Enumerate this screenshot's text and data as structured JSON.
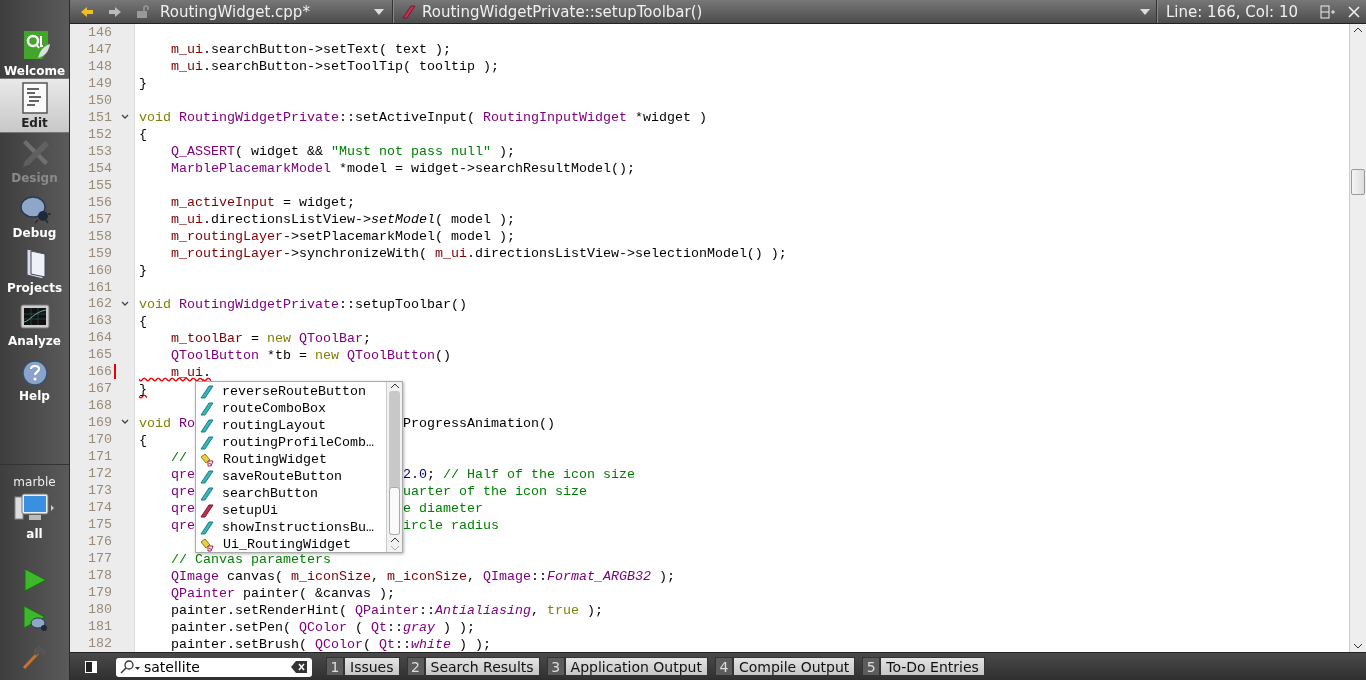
{
  "toolbar": {
    "file": "RoutingWidget.cpp*",
    "symbol": "RoutingWidgetPrivate::setupToolbar()",
    "position": "Line: 166, Col: 10"
  },
  "modes": [
    {
      "kind": "welcome",
      "label": "Welcome",
      "selected": false,
      "disabled": false
    },
    {
      "kind": "edit",
      "label": "Edit",
      "selected": true,
      "disabled": false
    },
    {
      "kind": "design",
      "label": "Design",
      "selected": false,
      "disabled": true
    },
    {
      "kind": "debug",
      "label": "Debug",
      "selected": false,
      "disabled": false
    },
    {
      "kind": "projects",
      "label": "Projects",
      "selected": false,
      "disabled": false
    },
    {
      "kind": "analyze",
      "label": "Analyze",
      "selected": false,
      "disabled": false
    },
    {
      "kind": "help",
      "label": "Help",
      "selected": false,
      "disabled": false
    }
  ],
  "target": {
    "project": "marble",
    "build": "all"
  },
  "editor": {
    "lines": [
      {
        "number": "146",
        "fold": false,
        "changed": false
      },
      {
        "number": "147",
        "fold": false,
        "changed": false,
        "error": false,
        "tokens": [
          {
            "kind": "field",
            "text": "    m_ui"
          },
          {
            "kind": "plain",
            "text": ".searchButton->setText( text );"
          }
        ]
      },
      {
        "number": "148",
        "fold": false,
        "changed": false,
        "error": false,
        "tokens": [
          {
            "kind": "field",
            "text": "    m_ui"
          },
          {
            "kind": "plain",
            "text": ".searchButton->setToolTip( tooltip );"
          }
        ]
      },
      {
        "number": "149",
        "fold": false,
        "changed": false,
        "error": false,
        "tokens": [
          {
            "kind": "plain",
            "text": "}"
          }
        ]
      },
      {
        "number": "150",
        "fold": false,
        "changed": false
      },
      {
        "number": "151",
        "fold": true,
        "changed": false,
        "error": false,
        "tokens": [
          {
            "kind": "keyword",
            "text": "void "
          },
          {
            "kind": "type",
            "text": "RoutingWidgetPrivate"
          },
          {
            "kind": "plain",
            "text": "::setActiveInput( "
          },
          {
            "kind": "type",
            "text": "RoutingInputWidget"
          },
          {
            "kind": "plain",
            "text": " *widget )"
          }
        ]
      },
      {
        "number": "152",
        "fold": false,
        "changed": false,
        "error": false,
        "tokens": [
          {
            "kind": "plain",
            "text": "{"
          }
        ]
      },
      {
        "number": "153",
        "fold": false,
        "changed": false,
        "error": false,
        "tokens": [
          {
            "kind": "type",
            "text": "    Q_ASSERT"
          },
          {
            "kind": "plain",
            "text": "( widget && "
          },
          {
            "kind": "string",
            "text": "\"Must not pass null\""
          },
          {
            "kind": "plain",
            "text": " );"
          }
        ]
      },
      {
        "number": "154",
        "fold": false,
        "changed": false,
        "error": false,
        "tokens": [
          {
            "kind": "type",
            "text": "    MarblePlacemarkModel"
          },
          {
            "kind": "plain",
            "text": " *model = widget->searchResultModel();"
          }
        ]
      },
      {
        "number": "155",
        "fold": false,
        "changed": false
      },
      {
        "number": "156",
        "fold": false,
        "changed": false,
        "error": false,
        "tokens": [
          {
            "kind": "field",
            "text": "    m_activeInput"
          },
          {
            "kind": "plain",
            "text": " = widget;"
          }
        ]
      },
      {
        "number": "157",
        "fold": false,
        "changed": false,
        "error": false,
        "tokens": [
          {
            "kind": "field",
            "text": "    m_ui"
          },
          {
            "kind": "plain",
            "text": ".directionsListView->"
          },
          {
            "kind": "virtual",
            "text": "setModel"
          },
          {
            "kind": "plain",
            "text": "( model );"
          }
        ]
      },
      {
        "number": "158",
        "fold": false,
        "changed": false,
        "error": false,
        "tokens": [
          {
            "kind": "field",
            "text": "    m_routingLayer"
          },
          {
            "kind": "plain",
            "text": "->setPlacemarkModel( model );"
          }
        ]
      },
      {
        "number": "159",
        "fold": false,
        "changed": false,
        "error": false,
        "tokens": [
          {
            "kind": "field",
            "text": "    m_routingLayer"
          },
          {
            "kind": "plain",
            "text": "->synchronizeWith( "
          },
          {
            "kind": "field",
            "text": "m_ui"
          },
          {
            "kind": "plain",
            "text": ".directionsListView->selectionModel() );"
          }
        ]
      },
      {
        "number": "160",
        "fold": false,
        "changed": false,
        "error": false,
        "tokens": [
          {
            "kind": "plain",
            "text": "}"
          }
        ]
      },
      {
        "number": "161",
        "fold": false,
        "changed": false
      },
      {
        "number": "162",
        "fold": true,
        "changed": false,
        "error": false,
        "tokens": [
          {
            "kind": "keyword",
            "text": "void "
          },
          {
            "kind": "type",
            "text": "RoutingWidgetPrivate"
          },
          {
            "kind": "plain",
            "text": "::setupToolbar()"
          }
        ]
      },
      {
        "number": "163",
        "fold": false,
        "changed": false,
        "error": false,
        "tokens": [
          {
            "kind": "plain",
            "text": "{"
          }
        ]
      },
      {
        "number": "164",
        "fold": false,
        "changed": false,
        "error": false,
        "tokens": [
          {
            "kind": "field",
            "text": "    m_toolBar"
          },
          {
            "kind": "plain",
            "text": " = "
          },
          {
            "kind": "keyword",
            "text": "new "
          },
          {
            "kind": "type",
            "text": "QToolBar"
          },
          {
            "kind": "plain",
            "text": ";"
          }
        ]
      },
      {
        "number": "165",
        "fold": false,
        "changed": false,
        "error": false,
        "tokens": [
          {
            "kind": "type",
            "text": "    QToolButton"
          },
          {
            "kind": "plain",
            "text": " *tb = "
          },
          {
            "kind": "keyword",
            "text": "new "
          },
          {
            "kind": "type",
            "text": "QToolButton"
          },
          {
            "kind": "plain",
            "text": "()"
          }
        ]
      },
      {
        "number": "166",
        "fold": false,
        "changed": true,
        "error": true,
        "tokens": [
          {
            "kind": "field",
            "text": "    m_ui"
          },
          {
            "kind": "plain",
            "text": "."
          }
        ]
      },
      {
        "number": "167",
        "fold": false,
        "changed": false,
        "error": true,
        "tokens": [
          {
            "kind": "plain",
            "text": "}"
          }
        ]
      },
      {
        "number": "168",
        "fold": false,
        "changed": false
      },
      {
        "number": "169",
        "fold": true,
        "changed": false,
        "error": false,
        "tokens": [
          {
            "kind": "keyword",
            "text": "void "
          },
          {
            "kind": "type",
            "text": "Ro"
          }
        ],
        "tokens_right": [
          {
            "kind": "plain",
            "text": "ProgressAnimation()"
          }
        ]
      },
      {
        "number": "170",
        "fold": false,
        "changed": false,
        "error": false,
        "tokens": [
          {
            "kind": "plain",
            "text": "{"
          }
        ]
      },
      {
        "number": "171",
        "fold": false,
        "changed": false,
        "error": false,
        "tokens": [
          {
            "kind": "comment",
            "text": "    //"
          }
        ]
      },
      {
        "number": "172",
        "fold": false,
        "changed": false,
        "error": false,
        "tokens": [
          {
            "kind": "type",
            "text": "    qre"
          }
        ],
        "tokens_right": [
          {
            "kind": "number",
            "text": "2.0"
          },
          {
            "kind": "plain",
            "text": "; "
          },
          {
            "kind": "comment",
            "text": "// Half of the icon size"
          }
        ]
      },
      {
        "number": "173",
        "fold": false,
        "changed": false,
        "error": false,
        "tokens": [
          {
            "kind": "type",
            "text": "    qre"
          }
        ],
        "tokens_right": [
          {
            "kind": "comment",
            "text": "uarter of the icon size"
          }
        ]
      },
      {
        "number": "174",
        "fold": false,
        "changed": false,
        "error": false,
        "tokens": [
          {
            "kind": "type",
            "text": "    qre"
          }
        ],
        "tokens_right": [
          {
            "kind": "comment",
            "text": "e diameter"
          }
        ]
      },
      {
        "number": "175",
        "fold": false,
        "changed": false,
        "error": false,
        "tokens": [
          {
            "kind": "type",
            "text": "    qre"
          }
        ],
        "tokens_right": [
          {
            "kind": "comment",
            "text": "ircle radius"
          }
        ]
      },
      {
        "number": "176",
        "fold": false,
        "changed": false
      },
      {
        "number": "177",
        "fold": false,
        "changed": false,
        "error": false,
        "tokens": [
          {
            "kind": "comment",
            "text": "    // Canvas parameters"
          }
        ]
      },
      {
        "number": "178",
        "fold": false,
        "changed": false,
        "error": false,
        "tokens": [
          {
            "kind": "type",
            "text": "    QImage"
          },
          {
            "kind": "plain",
            "text": " canvas( "
          },
          {
            "kind": "field",
            "text": "m_iconSize"
          },
          {
            "kind": "plain",
            "text": ", "
          },
          {
            "kind": "field",
            "text": "m_iconSize"
          },
          {
            "kind": "plain",
            "text": ", "
          },
          {
            "kind": "type",
            "text": "QImage"
          },
          {
            "kind": "plain",
            "text": "::"
          },
          {
            "kind": "enum",
            "text": "Format_ARGB32"
          },
          {
            "kind": "plain",
            "text": " );"
          }
        ]
      },
      {
        "number": "179",
        "fold": false,
        "changed": false,
        "error": false,
        "tokens": [
          {
            "kind": "type",
            "text": "    QPainter"
          },
          {
            "kind": "plain",
            "text": " painter( &canvas );"
          }
        ]
      },
      {
        "number": "180",
        "fold": false,
        "changed": false,
        "error": false,
        "tokens": [
          {
            "kind": "plain",
            "text": "    painter.setRenderHint( "
          },
          {
            "kind": "type",
            "text": "QPainter"
          },
          {
            "kind": "plain",
            "text": "::"
          },
          {
            "kind": "enum",
            "text": "Antialiasing"
          },
          {
            "kind": "plain",
            "text": ", "
          },
          {
            "kind": "keyword",
            "text": "true"
          },
          {
            "kind": "plain",
            "text": " );"
          }
        ]
      },
      {
        "number": "181",
        "fold": false,
        "changed": false,
        "error": false,
        "tokens": [
          {
            "kind": "plain",
            "text": "    painter.setPen( "
          },
          {
            "kind": "type",
            "text": "QColor"
          },
          {
            "kind": "plain",
            "text": " ( "
          },
          {
            "kind": "type",
            "text": "Qt"
          },
          {
            "kind": "plain",
            "text": "::"
          },
          {
            "kind": "enum",
            "text": "gray"
          },
          {
            "kind": "plain",
            "text": " ) );"
          }
        ]
      },
      {
        "number": "182",
        "fold": false,
        "changed": false,
        "error": false,
        "tokens": [
          {
            "kind": "plain",
            "text": "    painter.setBrush( "
          },
          {
            "kind": "type",
            "text": "QColor"
          },
          {
            "kind": "plain",
            "text": "( "
          },
          {
            "kind": "type",
            "text": "Qt"
          },
          {
            "kind": "plain",
            "text": "::"
          },
          {
            "kind": "enum",
            "text": "white"
          },
          {
            "kind": "plain",
            "text": " ) );"
          }
        ]
      }
    ],
    "completion": {
      "items": [
        {
          "kind": "member",
          "text": "reverseRouteButton",
          "selected": false
        },
        {
          "kind": "member",
          "text": "routeComboBox",
          "selected": false
        },
        {
          "kind": "member",
          "text": "routingLayout",
          "selected": false
        },
        {
          "kind": "member",
          "text": "routingProfileComb…",
          "selected": false
        },
        {
          "kind": "class",
          "text": "RoutingWidget",
          "selected": false
        },
        {
          "kind": "member",
          "text": "saveRouteButton",
          "selected": false
        },
        {
          "kind": "member",
          "text": "searchButton",
          "selected": false
        },
        {
          "kind": "function",
          "text": "setupUi",
          "selected": false
        },
        {
          "kind": "member",
          "text": "showInstructionsBu…",
          "selected": false
        },
        {
          "kind": "class",
          "text": "Ui_RoutingWidget",
          "selected": false
        }
      ]
    }
  },
  "locator": {
    "value": "satellite"
  },
  "output_panes": [
    {
      "number": "1",
      "label": "Issues"
    },
    {
      "number": "2",
      "label": "Search Results"
    },
    {
      "number": "3",
      "label": "Application Output"
    },
    {
      "number": "4",
      "label": "Compile Output"
    },
    {
      "number": "5",
      "label": "To-Do Entries"
    }
  ]
}
